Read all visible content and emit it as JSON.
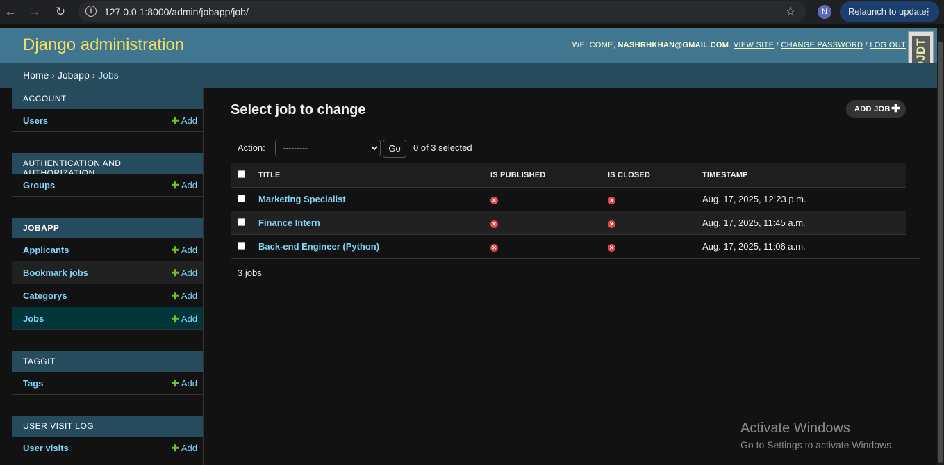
{
  "browser": {
    "url": "127.0.0.1:8000/admin/jobapp/job/",
    "profile_initial": "N",
    "relaunch_label": "Relaunch to update"
  },
  "header": {
    "branding": "Django administration",
    "welcome": "WELCOME, ",
    "user_email": "NASHRHKHAN@GMAIL.COM",
    "view_site": "VIEW SITE",
    "change_password": "CHANGE PASSWORD",
    "log_out": "LOG OUT",
    "sep": "/",
    "djdt": "DJDT"
  },
  "breadcrumbs": {
    "home": "Home",
    "app": "Jobapp",
    "current": "Jobs",
    "sep": "›"
  },
  "sidebar": {
    "toggle": "«",
    "add_label": "Add",
    "modules": [
      {
        "caption": "ACCOUNT",
        "items": [
          "Users"
        ]
      },
      {
        "caption": "AUTHENTICATION AND AUTHORIZATION",
        "items": [
          "Groups"
        ]
      },
      {
        "caption": "JOBAPP",
        "items": [
          "Applicants",
          "Bookmark jobs",
          "Categorys",
          "Jobs"
        ]
      },
      {
        "caption": "TAGGIT",
        "items": [
          "Tags"
        ]
      },
      {
        "caption": "USER VISIT LOG",
        "items": [
          "User visits"
        ]
      }
    ]
  },
  "main": {
    "title": "Select job to change",
    "add_button": "ADD JOB",
    "action_label": "Action:",
    "action_selected": "---------",
    "go_label": "Go",
    "selection_counter": "0 of 3 selected",
    "columns": [
      "TITLE",
      "IS PUBLISHED",
      "IS CLOSED",
      "TIMESTAMP"
    ],
    "rows": [
      {
        "title": "Marketing Specialist",
        "published": "no",
        "closed": "no",
        "timestamp": "Aug. 17, 2025, 12:23 p.m."
      },
      {
        "title": "Finance Intern",
        "published": "no",
        "closed": "no",
        "timestamp": "Aug. 17, 2025, 11:45 a.m."
      },
      {
        "title": "Back-end Engineer (Python)",
        "published": "no",
        "closed": "no",
        "timestamp": "Aug. 17, 2025, 11:06 a.m."
      }
    ],
    "paginator": "3 jobs"
  },
  "watermark": {
    "title": "Activate Windows",
    "subtitle": "Go to Settings to activate Windows."
  },
  "colors": {
    "header_bg": "#417690",
    "branding": "#f5dd5d",
    "caption_bg": "#264b5d",
    "link": "#81d4fa",
    "add_plus": "#70bf2b",
    "no_icon": "#dd4646"
  }
}
